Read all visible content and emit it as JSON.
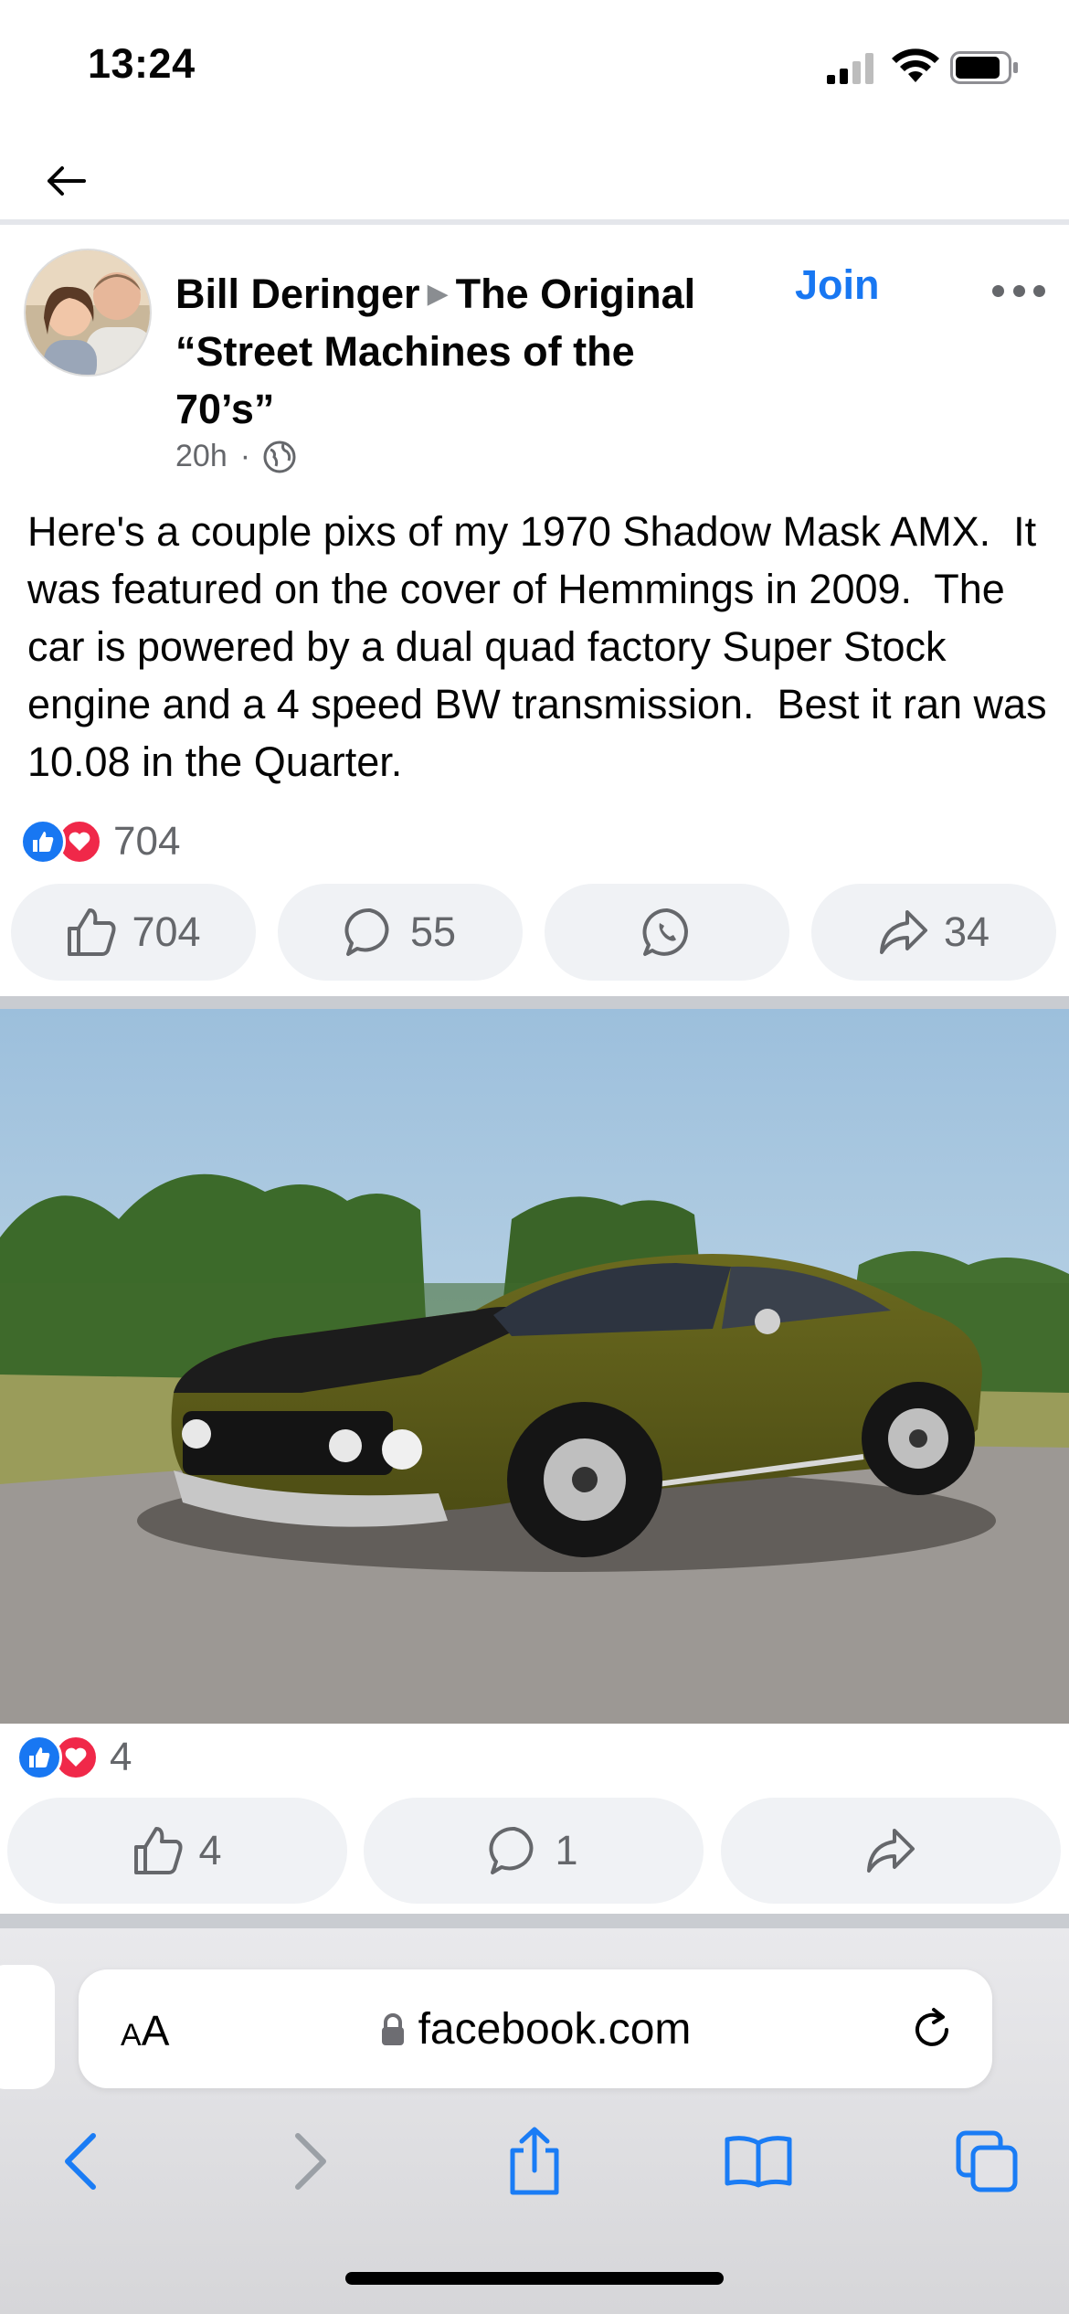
{
  "status_bar": {
    "time": "13:24"
  },
  "post": {
    "author": "Bill Deringer",
    "group": "The Original “Street Machines of the 70’s”",
    "join_label": "Join",
    "timestamp": "20h",
    "separator": "·",
    "body": "Here's a couple pixs of my 1970 Shadow Mask AMX.  It was featured on the cover of Hemmings in 2009.  The car is powered by a dual quad factory Super Stock engine and a 4 speed BW transmission.  Best it ran was 10.08 in the Quarter.",
    "reaction_count": "704",
    "actions": {
      "like_count": "704",
      "comment_count": "55",
      "share_count": "34"
    }
  },
  "photo": {
    "reaction_count": "4",
    "actions": {
      "like_count": "4",
      "comment_count": "1"
    }
  },
  "safari": {
    "aa_small": "A",
    "aa_large": "A",
    "url": "facebook.com"
  },
  "colors": {
    "accent": "#1877f2",
    "love": "#f02849",
    "secondary_text": "#65676b",
    "pill_bg": "#f0f2f5"
  }
}
